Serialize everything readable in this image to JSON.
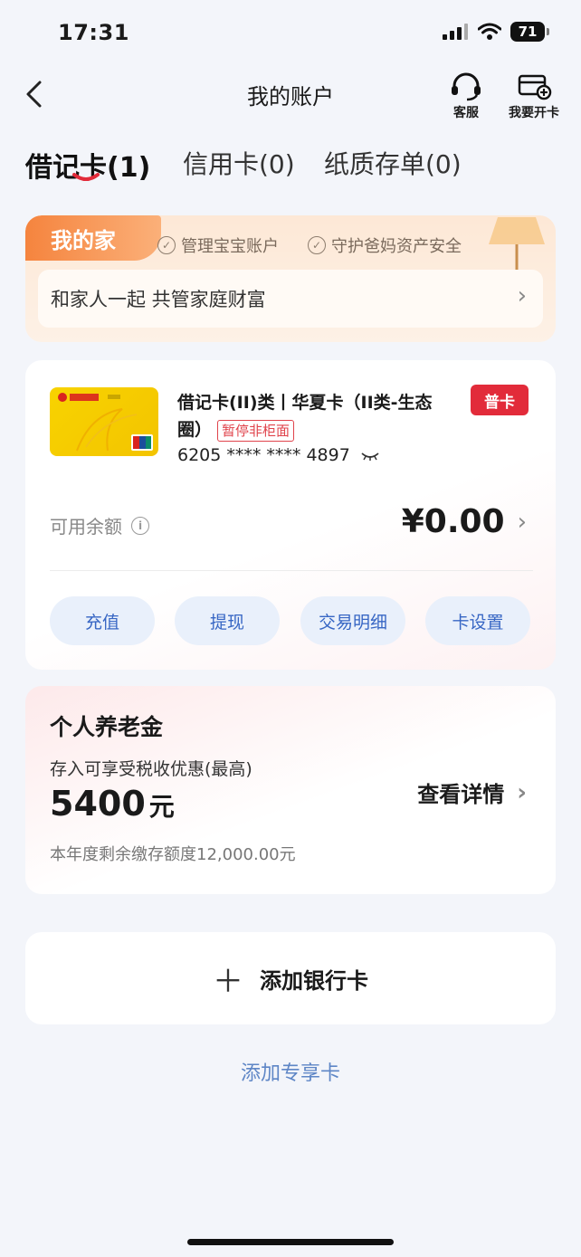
{
  "status": {
    "time": "17:31",
    "battery": "71"
  },
  "nav": {
    "title": "我的账户",
    "service_label": "客服",
    "open_card_label": "我要开卡"
  },
  "tabs": [
    {
      "label": "借记卡(1)"
    },
    {
      "label": "信用卡(0)"
    },
    {
      "label": "纸质存单(0)"
    }
  ],
  "family": {
    "badge": "我的家",
    "tags": [
      "管理宝宝账户",
      "守护爸妈资产安全"
    ],
    "slogan": "和家人一起 共管家庭财富"
  },
  "card": {
    "name": "借记卡(II)类丨华夏卡（II类-生态圈）",
    "status_tag": "暂停非柜面",
    "type_badge": "普卡",
    "number": "6205 **** **** 4897",
    "balance_label": "可用余额",
    "balance": "¥0.00",
    "actions": [
      "充值",
      "提现",
      "交易明细",
      "卡设置"
    ]
  },
  "pension": {
    "title": "个人养老金",
    "subtitle": "存入可享受税收优惠(最高)",
    "amount": "5400",
    "unit": "元",
    "note": "本年度剩余缴存额度12,000.00元",
    "detail_label": "查看详情"
  },
  "add_card_label": "添加银行卡",
  "exclusive_card_label": "添加专享卡",
  "colors": {
    "accent_blue": "#3766c4",
    "badge_red": "#e22b3a",
    "family_orange": "#f5843e"
  }
}
